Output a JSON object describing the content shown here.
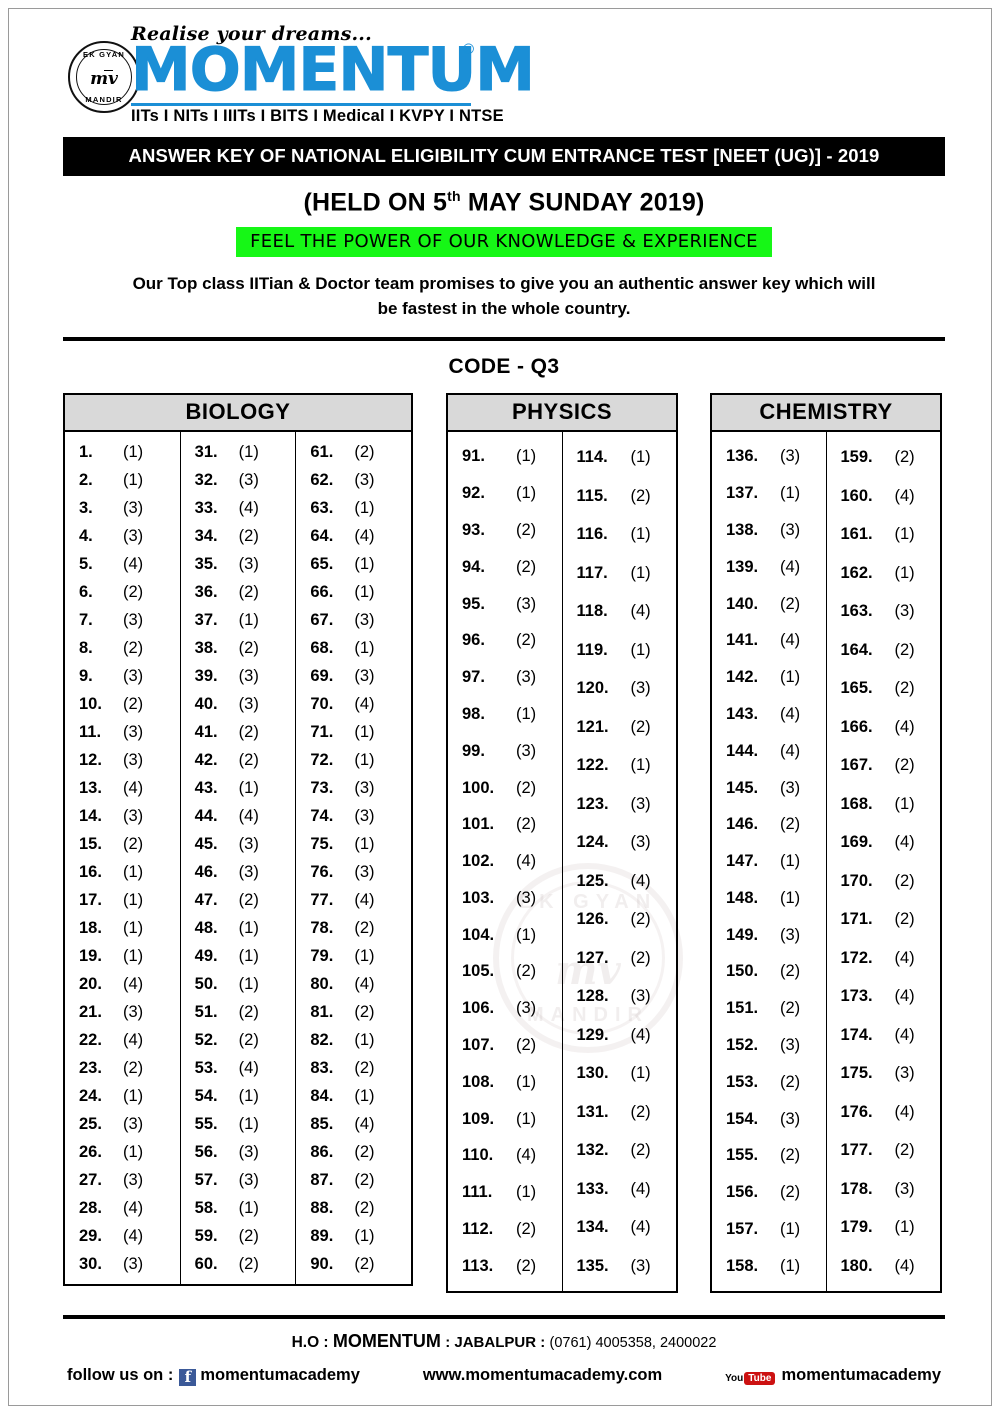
{
  "logo": {
    "tagline": "Realise your dreams...",
    "brand": "MOMENTUM",
    "registered_mark": "®",
    "seal_top": "EK GYAN",
    "seal_center": "mv",
    "seal_bottom": "MANDIR",
    "streams": "IITs I NITs I IIITs I BITS I Medical I KVPY I NTSE",
    "brand_color": "#1b8fd6"
  },
  "header": {
    "title_bar": "ANSWER KEY OF NATIONAL ELIGIBILITY CUM ENTRANCE TEST [NEET (UG)] - 2019",
    "held_on_prefix": "(HELD ON 5",
    "held_on_sup": "th",
    "held_on_suffix": " MAY SUNDAY  2019)",
    "green_banner": "FEEL THE POWER OF OUR KNOWLEDGE & EXPERIENCE",
    "green_banner_color": "#16f716",
    "promise_line1": "Our Top class IITian & Doctor team promises to give you an authentic answer key which will",
    "promise_line2": "be fastest in the whole country.",
    "code": "CODE - Q3"
  },
  "watermark": {
    "top": "EK GYAN",
    "center": "mv",
    "bottom": "MANDIR"
  },
  "subjects": [
    {
      "name": "BIOLOGY",
      "columns": [
        [
          {
            "q": "1.",
            "a": "(1)"
          },
          {
            "q": "2.",
            "a": "(1)"
          },
          {
            "q": "3.",
            "a": "(3)"
          },
          {
            "q": "4.",
            "a": "(3)"
          },
          {
            "q": "5.",
            "a": "(4)"
          },
          {
            "q": "6.",
            "a": "(2)"
          },
          {
            "q": "7.",
            "a": "(3)"
          },
          {
            "q": "8.",
            "a": "(2)"
          },
          {
            "q": "9.",
            "a": "(3)"
          },
          {
            "q": "10.",
            "a": "(2)"
          },
          {
            "q": "11.",
            "a": "(3)"
          },
          {
            "q": "12.",
            "a": "(3)"
          },
          {
            "q": "13.",
            "a": "(4)"
          },
          {
            "q": "14.",
            "a": "(3)"
          },
          {
            "q": "15.",
            "a": "(2)"
          },
          {
            "q": "16.",
            "a": "(1)"
          },
          {
            "q": "17.",
            "a": "(1)"
          },
          {
            "q": "18.",
            "a": "(1)"
          },
          {
            "q": "19.",
            "a": "(1)"
          },
          {
            "q": "20.",
            "a": "(4)"
          },
          {
            "q": "21.",
            "a": "(3)"
          },
          {
            "q": "22.",
            "a": "(4)"
          },
          {
            "q": "23.",
            "a": "(2)"
          },
          {
            "q": "24.",
            "a": "(1)"
          },
          {
            "q": "25.",
            "a": "(3)"
          },
          {
            "q": "26.",
            "a": "(1)"
          },
          {
            "q": "27.",
            "a": "(3)"
          },
          {
            "q": "28.",
            "a": "(4)"
          },
          {
            "q": "29.",
            "a": "(4)"
          },
          {
            "q": "30.",
            "a": "(3)"
          }
        ],
        [
          {
            "q": "31.",
            "a": "(1)"
          },
          {
            "q": "32.",
            "a": "(3)"
          },
          {
            "q": "33.",
            "a": "(4)"
          },
          {
            "q": "34.",
            "a": "(2)"
          },
          {
            "q": "35.",
            "a": "(3)"
          },
          {
            "q": "36.",
            "a": "(2)"
          },
          {
            "q": "37.",
            "a": "(1)"
          },
          {
            "q": "38.",
            "a": "(2)"
          },
          {
            "q": "39.",
            "a": "(3)"
          },
          {
            "q": "40.",
            "a": "(3)"
          },
          {
            "q": "41.",
            "a": "(2)"
          },
          {
            "q": "42.",
            "a": "(2)"
          },
          {
            "q": "43.",
            "a": "(1)"
          },
          {
            "q": "44.",
            "a": "(4)"
          },
          {
            "q": "45.",
            "a": "(3)"
          },
          {
            "q": "46.",
            "a": "(3)"
          },
          {
            "q": "47.",
            "a": "(2)"
          },
          {
            "q": "48.",
            "a": "(1)"
          },
          {
            "q": "49.",
            "a": "(1)"
          },
          {
            "q": "50.",
            "a": "(1)"
          },
          {
            "q": "51.",
            "a": "(2)"
          },
          {
            "q": "52.",
            "a": "(2)"
          },
          {
            "q": "53.",
            "a": "(4)"
          },
          {
            "q": "54.",
            "a": "(1)"
          },
          {
            "q": "55.",
            "a": "(1)"
          },
          {
            "q": "56.",
            "a": "(3)"
          },
          {
            "q": "57.",
            "a": "(3)"
          },
          {
            "q": "58.",
            "a": "(1)"
          },
          {
            "q": "59.",
            "a": "(2)"
          },
          {
            "q": "60.",
            "a": "(2)"
          }
        ],
        [
          {
            "q": "61.",
            "a": "(2)"
          },
          {
            "q": "62.",
            "a": "(3)"
          },
          {
            "q": "63.",
            "a": "(1)"
          },
          {
            "q": "64.",
            "a": "(4)"
          },
          {
            "q": "65.",
            "a": "(1)"
          },
          {
            "q": "66.",
            "a": "(1)"
          },
          {
            "q": "67.",
            "a": "(3)"
          },
          {
            "q": "68.",
            "a": "(1)"
          },
          {
            "q": "69.",
            "a": "(3)"
          },
          {
            "q": "70.",
            "a": "(4)"
          },
          {
            "q": "71.",
            "a": "(1)"
          },
          {
            "q": "72.",
            "a": "(1)"
          },
          {
            "q": "73.",
            "a": "(3)"
          },
          {
            "q": "74.",
            "a": "(3)"
          },
          {
            "q": "75.",
            "a": "(1)"
          },
          {
            "q": "76.",
            "a": "(3)"
          },
          {
            "q": "77.",
            "a": "(4)"
          },
          {
            "q": "78.",
            "a": "(2)"
          },
          {
            "q": "79.",
            "a": "(1)"
          },
          {
            "q": "80.",
            "a": "(4)"
          },
          {
            "q": "81.",
            "a": "(2)"
          },
          {
            "q": "82.",
            "a": "(1)"
          },
          {
            "q": "83.",
            "a": "(2)"
          },
          {
            "q": "84.",
            "a": "(1)"
          },
          {
            "q": "85.",
            "a": "(4)"
          },
          {
            "q": "86.",
            "a": "(2)"
          },
          {
            "q": "87.",
            "a": "(2)"
          },
          {
            "q": "88.",
            "a": "(2)"
          },
          {
            "q": "89.",
            "a": "(1)"
          },
          {
            "q": "90.",
            "a": "(2)"
          }
        ]
      ]
    },
    {
      "name": "PHYSICS",
      "columns": [
        [
          {
            "q": "91.",
            "a": "(1)"
          },
          {
            "q": "92.",
            "a": "(1)"
          },
          {
            "q": "93.",
            "a": "(2)"
          },
          {
            "q": "94.",
            "a": "(2)"
          },
          {
            "q": "95.",
            "a": "(3)"
          },
          {
            "q": "96.",
            "a": "(2)"
          },
          {
            "q": "97.",
            "a": "(3)"
          },
          {
            "q": "98.",
            "a": "(1)"
          },
          {
            "q": "99.",
            "a": "(3)"
          },
          {
            "q": "100.",
            "a": "(2)"
          },
          {
            "q": "101.",
            "a": "(2)"
          },
          {
            "q": "102.",
            "a": "(4)"
          },
          {
            "q": "103.",
            "a": "(3)"
          },
          {
            "q": "104.",
            "a": "(1)"
          },
          {
            "q": "105.",
            "a": "(2)"
          },
          {
            "q": "106.",
            "a": "(3)"
          },
          {
            "q": "107.",
            "a": "(2)"
          },
          {
            "q": "108.",
            "a": "(1)"
          },
          {
            "q": "109.",
            "a": "(1)"
          },
          {
            "q": "110.",
            "a": "(4)"
          },
          {
            "q": "111.",
            "a": "(1)"
          },
          {
            "q": "112.",
            "a": "(2)"
          },
          {
            "q": "113.",
            "a": "(2)"
          }
        ],
        [
          {
            "q": "114.",
            "a": "(1)"
          },
          {
            "q": "115.",
            "a": "(2)"
          },
          {
            "q": "116.",
            "a": "(1)"
          },
          {
            "q": "117.",
            "a": "(1)"
          },
          {
            "q": "118.",
            "a": "(4)"
          },
          {
            "q": "119.",
            "a": "(1)"
          },
          {
            "q": "120.",
            "a": "(3)"
          },
          {
            "q": "121.",
            "a": "(2)"
          },
          {
            "q": "122.",
            "a": "(1)"
          },
          {
            "q": "123.",
            "a": "(3)"
          },
          {
            "q": "124.",
            "a": "(3)"
          },
          {
            "q": "125.",
            "a": "(4)"
          },
          {
            "q": "126.",
            "a": "(2)"
          },
          {
            "q": "127.",
            "a": "(2)"
          },
          {
            "q": "128.",
            "a": "(3)"
          },
          {
            "q": "129.",
            "a": "(4)"
          },
          {
            "q": "130.",
            "a": "(1)"
          },
          {
            "q": "131.",
            "a": "(2)"
          },
          {
            "q": "132.",
            "a": "(2)"
          },
          {
            "q": "133.",
            "a": "(4)"
          },
          {
            "q": "134.",
            "a": "(4)"
          },
          {
            "q": "135.",
            "a": "(3)"
          }
        ]
      ]
    },
    {
      "name": "CHEMISTRY",
      "columns": [
        [
          {
            "q": "136.",
            "a": "(3)"
          },
          {
            "q": "137.",
            "a": "(1)"
          },
          {
            "q": "138.",
            "a": "(3)"
          },
          {
            "q": "139.",
            "a": "(4)"
          },
          {
            "q": "140.",
            "a": "(2)"
          },
          {
            "q": "141.",
            "a": "(4)"
          },
          {
            "q": "142.",
            "a": "(1)"
          },
          {
            "q": "143.",
            "a": "(4)"
          },
          {
            "q": "144.",
            "a": "(4)"
          },
          {
            "q": "145.",
            "a": "(3)"
          },
          {
            "q": "146.",
            "a": "(2)"
          },
          {
            "q": "147.",
            "a": "(1)"
          },
          {
            "q": "148.",
            "a": "(1)"
          },
          {
            "q": "149.",
            "a": "(3)"
          },
          {
            "q": "150.",
            "a": "(2)"
          },
          {
            "q": "151.",
            "a": "(2)"
          },
          {
            "q": "152.",
            "a": "(3)"
          },
          {
            "q": "153.",
            "a": "(2)"
          },
          {
            "q": "154.",
            "a": "(3)"
          },
          {
            "q": "155.",
            "a": "(2)"
          },
          {
            "q": "156.",
            "a": "(2)"
          },
          {
            "q": "157.",
            "a": "(1)"
          },
          {
            "q": "158.",
            "a": "(1)"
          }
        ],
        [
          {
            "q": "159.",
            "a": "(2)"
          },
          {
            "q": "160.",
            "a": "(4)"
          },
          {
            "q": "161.",
            "a": "(1)"
          },
          {
            "q": "162.",
            "a": "(1)"
          },
          {
            "q": "163.",
            "a": "(3)"
          },
          {
            "q": "164.",
            "a": "(2)"
          },
          {
            "q": "165.",
            "a": "(2)"
          },
          {
            "q": "166.",
            "a": "(4)"
          },
          {
            "q": "167.",
            "a": "(2)"
          },
          {
            "q": "168.",
            "a": "(1)"
          },
          {
            "q": "169.",
            "a": "(4)"
          },
          {
            "q": "170.",
            "a": "(2)"
          },
          {
            "q": "171.",
            "a": "(2)"
          },
          {
            "q": "172.",
            "a": "(4)"
          },
          {
            "q": "173.",
            "a": "(4)"
          },
          {
            "q": "174.",
            "a": "(4)"
          },
          {
            "q": "175.",
            "a": "(3)"
          },
          {
            "q": "176.",
            "a": "(4)"
          },
          {
            "q": "177.",
            "a": "(2)"
          },
          {
            "q": "178.",
            "a": "(3)"
          },
          {
            "q": "179.",
            "a": "(1)"
          },
          {
            "q": "180.",
            "a": "(4)"
          }
        ]
      ]
    }
  ],
  "footer": {
    "ho_label": "H.O :",
    "ho_brand": "MOMENTUM",
    "ho_city": ": JABALPUR :",
    "ho_phone": "(0761) 4005358, 2400022",
    "follow_label": "follow us on :",
    "facebook_handle": "momentumacademy",
    "website": "www.momentumacademy.com",
    "youtube_handle": "momentumacademy",
    "facebook_glyph": "f",
    "youtube_you": "You",
    "youtube_tube": "Tube"
  }
}
